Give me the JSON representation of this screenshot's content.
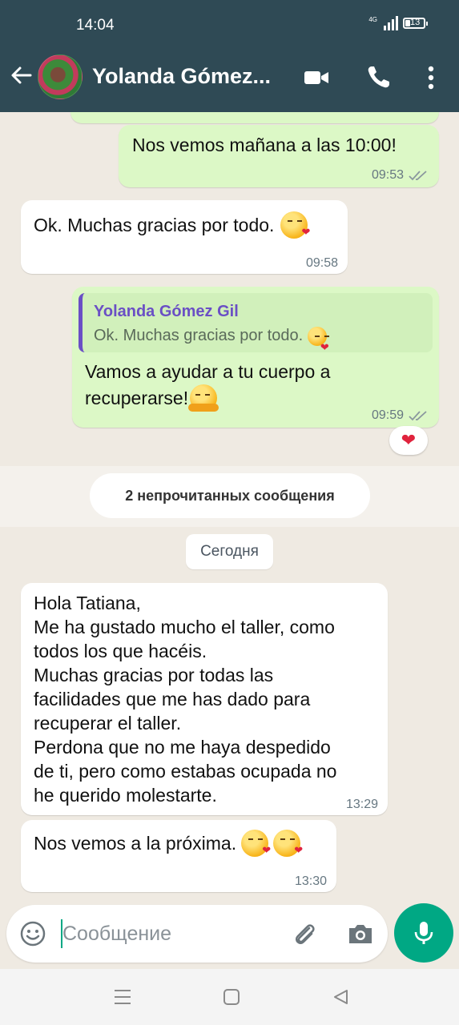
{
  "status_bar": {
    "time": "14:04",
    "network": "4G",
    "battery": "13"
  },
  "header": {
    "contact_name": "Yolanda Gómez..."
  },
  "messages": [
    {
      "id": "m1",
      "direction": "out",
      "text": "Nos vemos mañana a las 10:00!",
      "time": "09:53"
    },
    {
      "id": "m2",
      "direction": "in",
      "text": "Ok. Muchas gracias por todo.",
      "time": "09:58",
      "emoji": "kissing-heart"
    },
    {
      "id": "m3",
      "direction": "out",
      "quote": {
        "author": "Yolanda Gómez Gil",
        "text": "Ok. Muchas gracias por todo."
      },
      "lines": [
        "Vamos a ayudar a tu cuerpo a",
        "recuperarse!"
      ],
      "time": "09:59",
      "emoji": "hugging-face",
      "reaction": "❤"
    },
    {
      "id": "m4",
      "direction": "in",
      "lines": [
        "Hola Tatiana,",
        "Me ha gustado mucho el taller, como",
        "todos los que hacéis.",
        "Muchas gracias por todas las",
        "facilidades que me has dado para",
        "recuperar el taller.",
        "Perdona que no me haya despedido",
        "de ti, pero como estabas ocupada no",
        "he querido molestarte."
      ],
      "time": "13:29"
    },
    {
      "id": "m5",
      "direction": "in",
      "text": "Nos vemos a la próxima.",
      "time": "13:30",
      "emoji": "kissing-heart x2"
    }
  ],
  "unread_banner": "2 непрочитанных сообщения",
  "date_divider": "Сегодня",
  "composer": {
    "placeholder": "Сообщение"
  },
  "colors": {
    "header": "#2f4a55",
    "outgoing": "#dcf8c6",
    "incoming": "#ffffff",
    "accent": "#00a884",
    "quote_author": "#6a4fc5"
  },
  "icons": [
    "back-arrow-icon",
    "video-call-icon",
    "phone-icon",
    "more-vert-icon",
    "emoji-icon",
    "attach-icon",
    "camera-icon",
    "mic-icon",
    "nav-menu-icon",
    "nav-home-icon",
    "nav-back-icon"
  ]
}
